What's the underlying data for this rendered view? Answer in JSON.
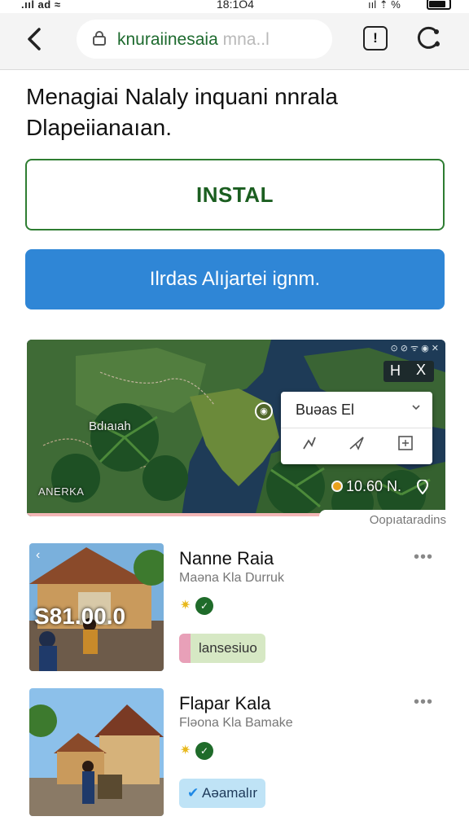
{
  "status_bar": {
    "carrier": ".ııl ad ≈",
    "time": "18:1O4",
    "signal": "ııl ⇡ %"
  },
  "browser": {
    "url_main": "knuraiinesaia",
    "url_faded": "mna..l",
    "tabs_count": "!",
    "icons": [
      "back-arrow-icon",
      "lock-icon",
      "tabs-icon",
      "menu-icon"
    ]
  },
  "headline": "Menagiai Nalaly inquani nnrala Dlapeiianaıan.",
  "buttons": {
    "install": "INSTAL",
    "primary": "Ilrdas Alıjartei ignm."
  },
  "map": {
    "place_label": "Bdıaıah",
    "region_label": "ANERKA",
    "popup_title": "Buəas El",
    "time_readout": "10.60 N.",
    "close_label": "X",
    "pause_label": "H",
    "caption": "Oopıataradins"
  },
  "listings": [
    {
      "name": "Nanne Raia",
      "subtitle": "Maəna Kla Durruk",
      "price": "S81.00.0",
      "tag": "lansesiuo",
      "tag_style": "green"
    },
    {
      "name": "Flapar Kala",
      "subtitle": "Fləona Kla Bamake",
      "price": "",
      "tag": "Aəamalır",
      "tag_style": "blue"
    }
  ],
  "colors": {
    "install_border": "#2e7d32",
    "primary_button": "#2f86d6",
    "url_text": "#1d6a2e",
    "map_water": "#1e3b57"
  }
}
